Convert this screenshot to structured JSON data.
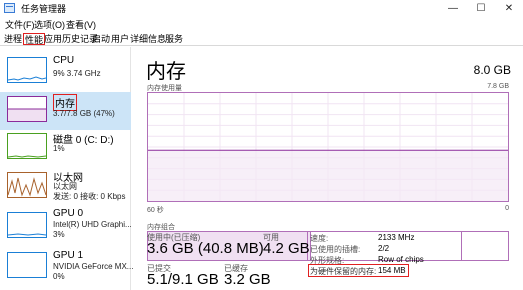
{
  "window": {
    "title": "任务管理器",
    "minimize": "—",
    "maximize": "☐",
    "close": "✕"
  },
  "menu": [
    "文件(F)",
    "选项(O)",
    "查看(V)"
  ],
  "tabs": [
    "进程",
    "性能",
    "应用历史记录",
    "启动",
    "用户",
    "详细信息",
    "服务"
  ],
  "sidebar": {
    "items": [
      {
        "name": "CPU",
        "sub1": "9%  3.74 GHz",
        "sub2": "",
        "color": "#1a7fd6",
        "icon": "cpu-graph-icon"
      },
      {
        "name": "内存",
        "sub1": "3.7/7.8 GB (47%)",
        "sub2": "",
        "color": "#8b2b9a",
        "icon": "memory-graph-icon"
      },
      {
        "name": "磁盘 0 (C: D:)",
        "sub1": "1%",
        "sub2": "",
        "color": "#4aa020",
        "icon": "disk-graph-icon"
      },
      {
        "name": "以太网",
        "sub1": "以太网",
        "sub2": "发送: 0 接收: 0 Kbps",
        "color": "#a8622c",
        "icon": "ethernet-graph-icon"
      },
      {
        "name": "GPU 0",
        "sub1": "Intel(R) UHD Graphi...",
        "sub2": "3%",
        "color": "#1a7fd6",
        "icon": "gpu0-graph-icon"
      },
      {
        "name": "GPU 1",
        "sub1": "NVIDIA GeForce MX...",
        "sub2": "0%",
        "color": "#1a7fd6",
        "icon": "gpu1-graph-icon"
      }
    ]
  },
  "main": {
    "title": "内存",
    "total": "8.0 GB",
    "graph_label": "内存使用量",
    "graph_max": "7.8 GB",
    "graph_time": "60 秒",
    "graph_min": "0",
    "compose_label": "内存组合",
    "stats": {
      "in_use_label": "使用中(已压缩)",
      "in_use_value": "3.6 GB (40.8 MB)",
      "available_label": "可用",
      "available_value": "4.2 GB",
      "committed_label": "已提交",
      "committed_value": "5.1/9.1 GB",
      "cached_label": "已缓存",
      "cached_value": "3.2 GB"
    },
    "details": [
      {
        "label": "速度:",
        "value": "2133 MHz"
      },
      {
        "label": "已使用的插槽:",
        "value": "2/2"
      },
      {
        "label": "外形规格:",
        "value": "Row of chips"
      },
      {
        "label": "为硬件保留的内存:",
        "value": "154 MB"
      }
    ],
    "usage_fraction": 0.47
  }
}
